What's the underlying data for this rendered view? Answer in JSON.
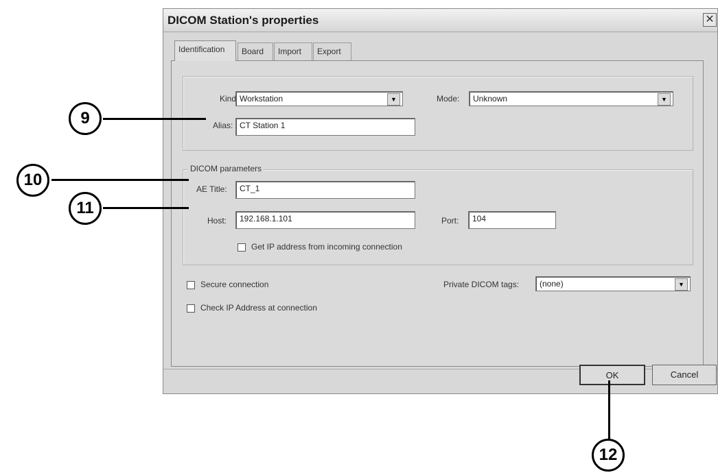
{
  "window": {
    "title": "DICOM Station's properties",
    "close_glyph": "✕"
  },
  "tabs": [
    {
      "label": "Identification"
    },
    {
      "label": "Board"
    },
    {
      "label": "Import"
    },
    {
      "label": "Export"
    }
  ],
  "identification": {
    "kind_label": "Kind:",
    "kind_value": "Workstation",
    "mode_label": "Mode:",
    "mode_value": "Unknown",
    "alias_label": "Alias:",
    "alias_value": "CT Station 1"
  },
  "dicom_params": {
    "legend": "DICOM parameters",
    "ae_title_label": "AE Title:",
    "ae_title_value": "CT_1",
    "host_label": "Host:",
    "host_value": "192.168.1.101",
    "port_label": "Port:",
    "port_value": "104",
    "get_ip_label": "Get IP address from incoming connection"
  },
  "options": {
    "secure_label": "Secure connection",
    "check_ip_label": "Check IP Address at connection",
    "private_tags_label": "Private DICOM tags:",
    "private_tags_value": "(none)"
  },
  "buttons": {
    "ok": "OK",
    "cancel": "Cancel"
  },
  "callouts": [
    "9",
    "10",
    "11",
    "12"
  ],
  "icons": {
    "dropdown_arrow": "▼"
  }
}
